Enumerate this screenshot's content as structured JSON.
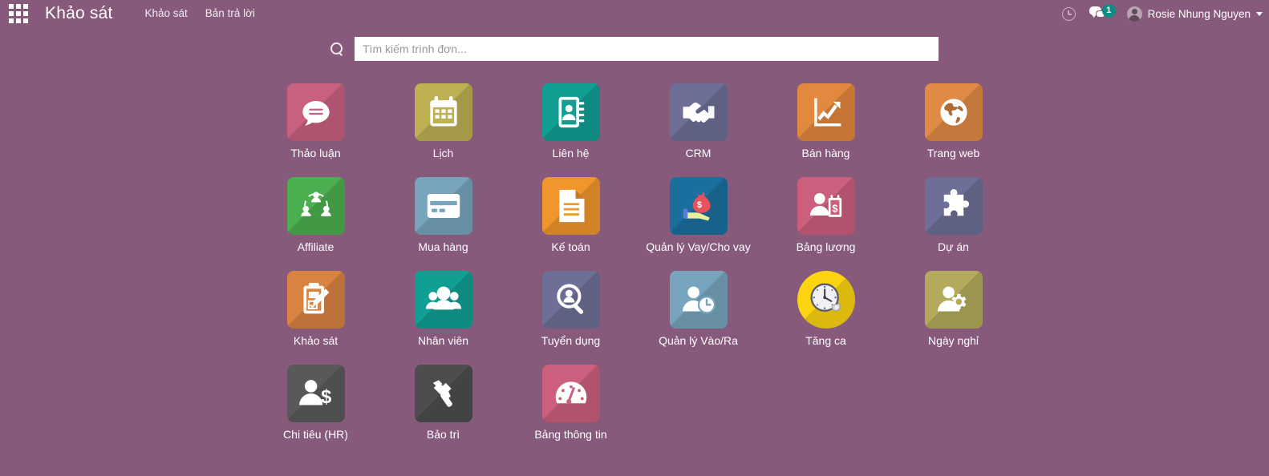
{
  "navbar": {
    "apps_menu_icon": "grid-icon",
    "brand": "Khảo sát",
    "links": [
      {
        "label": "Khảo sát"
      },
      {
        "label": "Bản trả lời"
      }
    ],
    "activity_icon": "clock-icon",
    "messaging_icon": "chat-icon",
    "messaging_badge": "1",
    "user_avatar_icon": "avatar-icon",
    "user_name": "Rosie Nhung Nguyen",
    "dropdown_icon": "caret-down-icon"
  },
  "search": {
    "icon": "search-icon",
    "placeholder": "Tìm kiếm trình đơn...",
    "value": ""
  },
  "colors": {
    "background": "#875A7B",
    "navbar": "#875A7B",
    "badge": "#0d8b84",
    "label_text": "#ffffff"
  },
  "apps": [
    [
      {
        "label": "Thảo luận",
        "icon": "chat-bubble-icon",
        "color": "#c8607f",
        "shape": "rounded"
      },
      {
        "label": "Lịch",
        "icon": "calendar-icon",
        "color": "#bdb154",
        "shape": "rounded"
      },
      {
        "label": "Liên hệ",
        "icon": "address-book-icon",
        "color": "#119e93",
        "shape": "rounded"
      },
      {
        "label": "CRM",
        "icon": "handshake-icon",
        "color": "#6d6f96",
        "shape": "rounded"
      },
      {
        "label": "Bán hàng",
        "icon": "growth-chart-icon",
        "color": "#e2883f",
        "shape": "rounded"
      },
      {
        "label": "Trang web",
        "icon": "globe-icon",
        "color": "#e08a45",
        "shape": "rounded"
      }
    ],
    [
      {
        "label": "Affiliate",
        "icon": "network-people-icon",
        "color": "#4caf4f",
        "shape": "rounded"
      },
      {
        "label": "Mua hàng",
        "icon": "credit-card-icon",
        "color": "#76a5bd",
        "shape": "rounded"
      },
      {
        "label": "Kế toán",
        "icon": "document-icon",
        "color": "#f0962d",
        "shape": "rounded"
      },
      {
        "label": "Quản lý Vay/Cho vay",
        "icon": "money-bag-hand-icon",
        "color": "#1a6f9e",
        "shape": "rounded"
      },
      {
        "label": "Bảng lương",
        "icon": "person-payslip-icon",
        "color": "#cc5f7d",
        "shape": "rounded"
      },
      {
        "label": "Dự án",
        "icon": "puzzle-piece-icon",
        "color": "#6d6f96",
        "shape": "rounded"
      }
    ],
    [
      {
        "label": "Khảo sát",
        "icon": "clipboard-pencil-icon",
        "color": "#d88341",
        "shape": "rounded"
      },
      {
        "label": "Nhân viên",
        "icon": "people-group-icon",
        "color": "#119e93",
        "shape": "rounded"
      },
      {
        "label": "Tuyển dụng",
        "icon": "magnifier-person-icon",
        "color": "#6d6f96",
        "shape": "rounded"
      },
      {
        "label": "Quản lý Vào/Ra",
        "icon": "person-clock-icon",
        "color": "#76a5bd",
        "shape": "rounded"
      },
      {
        "label": "Tăng ca",
        "icon": "clock-gear-icon",
        "color": "#fcd411",
        "shape": "circle"
      },
      {
        "label": "Ngày nghỉ",
        "icon": "person-gear-icon",
        "color": "#b3ab5b",
        "shape": "rounded"
      }
    ],
    [
      {
        "label": "Chi tiêu (HR)",
        "icon": "person-dollar-icon",
        "color": "#595959",
        "shape": "rounded"
      },
      {
        "label": "Bảo trì",
        "icon": "hammer-icon",
        "color": "#4d4d4d",
        "shape": "rounded"
      },
      {
        "label": "Bảng thông tin",
        "icon": "gauge-icon",
        "color": "#cc5f7d",
        "shape": "rounded"
      }
    ]
  ]
}
